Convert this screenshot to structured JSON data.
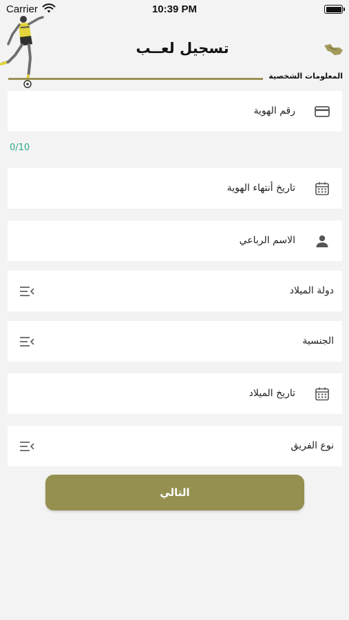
{
  "status_bar": {
    "carrier": "Carrier",
    "time": "10:39 PM"
  },
  "header": {
    "title": "تسجيل لعــب",
    "section_label": "المعلومات الشخصية"
  },
  "form": {
    "id_number_placeholder": "رقم الهوية",
    "id_counter": "0/10",
    "id_expiry_label": "تاريخ أنتهاء الهوية",
    "full_name_placeholder": "الاسم الرباعي",
    "birth_country_label": "دولة الميلاد",
    "nationality_label": "الجنسية",
    "birth_date_label": "تاريخ الميلاد",
    "team_type_label": "نوع الفريق"
  },
  "next_button": {
    "label": "التالي"
  },
  "colors": {
    "accent": "#959050",
    "counter": "#2aa68a",
    "background": "#f3f3f3"
  },
  "icons": {
    "id_number": "id-card-icon",
    "id_expiry": "calendar-icon",
    "full_name": "person-icon",
    "birth_country": "sort-menu-icon",
    "nationality": "sort-menu-icon",
    "birth_date": "calendar-icon",
    "team_type": "sort-menu-icon",
    "back": "back-arrow-icon"
  }
}
